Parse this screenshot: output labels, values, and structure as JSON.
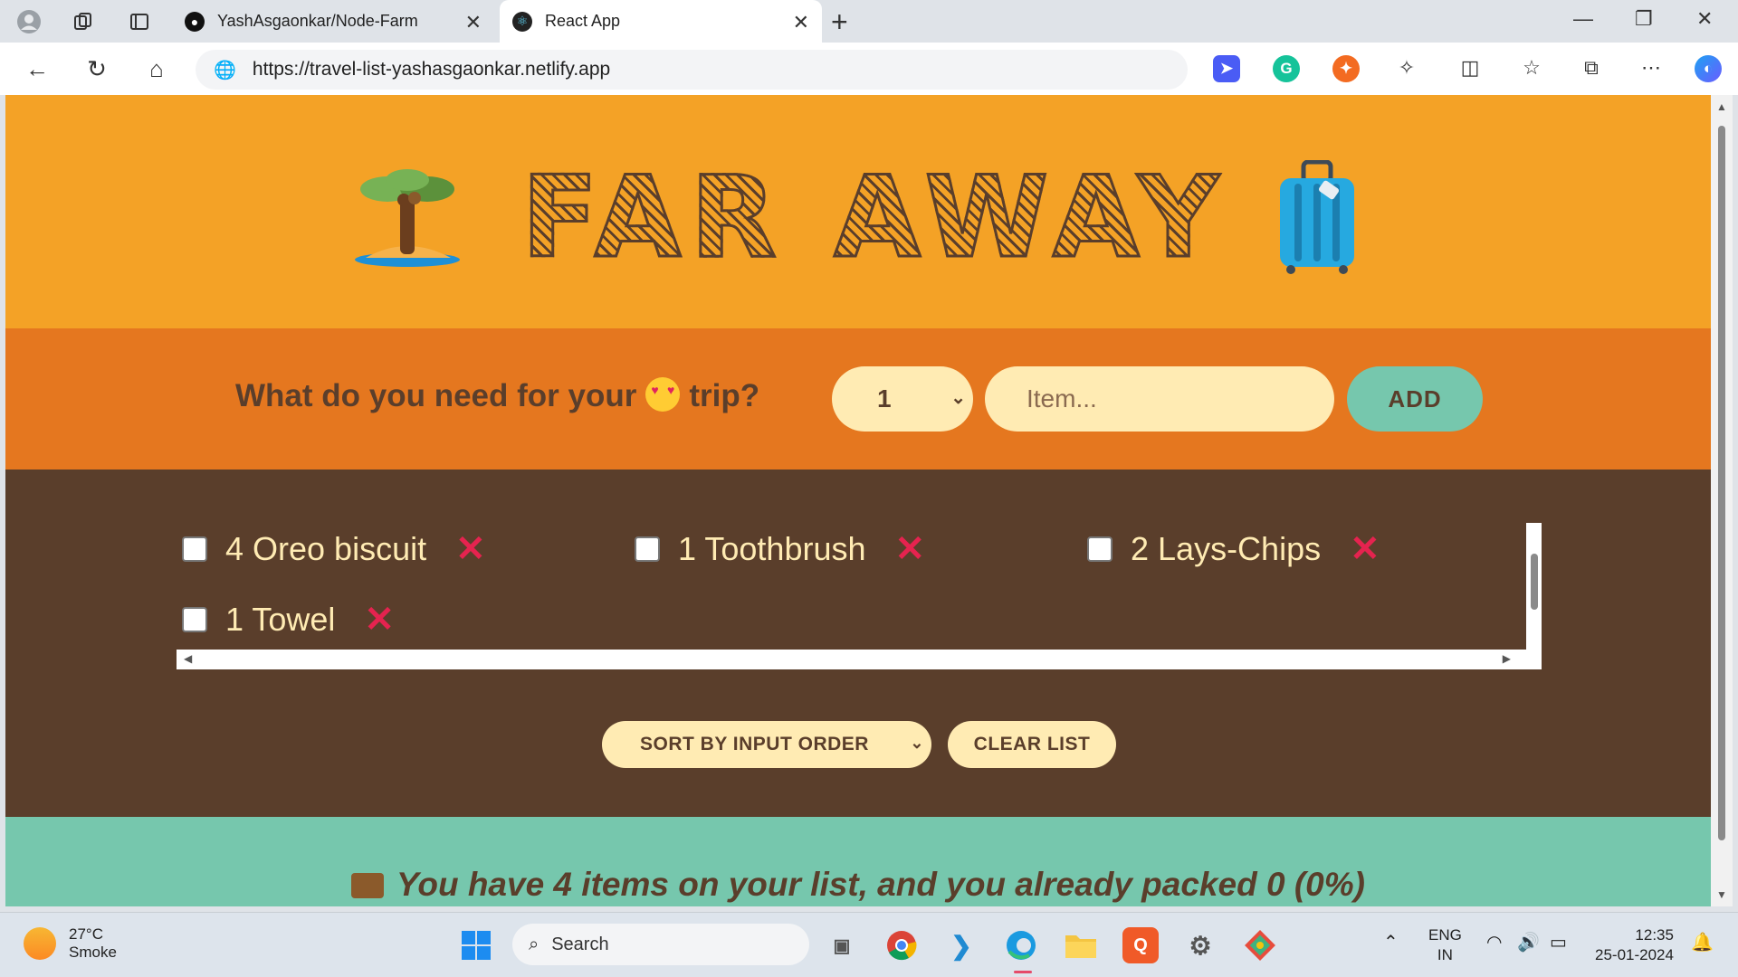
{
  "browser": {
    "tabs": [
      {
        "title": "YashAsgaonkar/Node-Farm",
        "active": false
      },
      {
        "title": "React App",
        "active": true
      }
    ],
    "url": "https://travel-list-yashasgaonkar.netlify.app"
  },
  "app": {
    "logo_text": "FAR AWAY",
    "form": {
      "question_before": "What do you need for your",
      "question_after": "trip?",
      "quantity_selected": "1",
      "item_placeholder": "Item...",
      "add_label": "ADD"
    },
    "items": [
      {
        "quantity": 4,
        "description": "Oreo biscuit",
        "label": "4 Oreo biscuit",
        "packed": false,
        "delete_symbol": "✕"
      },
      {
        "quantity": 1,
        "description": "Toothbrush",
        "label": "1 Toothbrush",
        "packed": false,
        "delete_symbol": "✕"
      },
      {
        "quantity": 2,
        "description": "Lays-Chips",
        "label": "2 Lays-Chips",
        "packed": false,
        "delete_symbol": "✕"
      },
      {
        "quantity": 1,
        "description": "Towel",
        "label": "1 Towel",
        "packed": false,
        "delete_symbol": "✕"
      }
    ],
    "sort_selected": "SORT BY INPUT ORDER",
    "clear_label": "CLEAR LIST",
    "stats": "You have 4 items on your list, and you already packed 0 (0%)"
  },
  "taskbar": {
    "weather_temp": "27°C",
    "weather_cond": "Smoke",
    "search_label": "Search",
    "lang_top": "ENG",
    "lang_bottom": "IN",
    "time": "12:35",
    "date": "25-01-2024"
  },
  "colors": {
    "header": "#f4a226",
    "form": "#e5771f",
    "list": "#5a3e2b",
    "stats": "#76c7ad",
    "cream": "#ffebb3",
    "delete": "#e5234f"
  }
}
